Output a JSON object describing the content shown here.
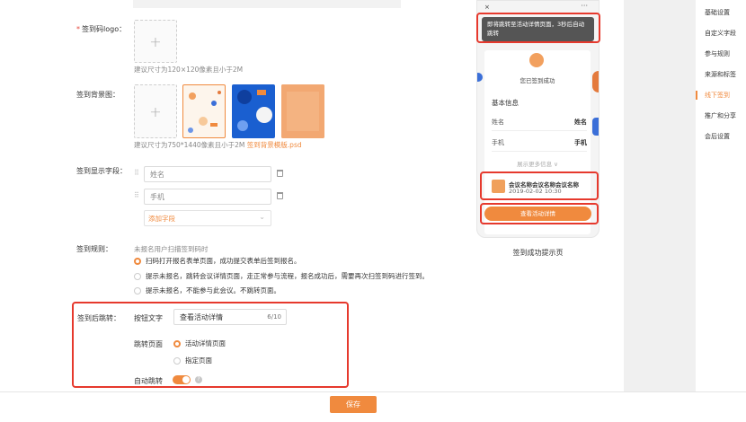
{
  "form": {
    "logo": {
      "label": "签到码logo：",
      "hint": "建议尺寸为120×120像素且小于2M",
      "upload_symbol": "+"
    },
    "background": {
      "label": "签到背景图：",
      "hint": "建议尺寸为750*1440像素且小于2M",
      "template_link": "签到背景模版.psd",
      "upload_symbol": "+"
    },
    "fields": {
      "label": "签到显示字段：",
      "items": [
        "姓名",
        "手机"
      ],
      "add_label": "添加字段"
    },
    "rule": {
      "label": "签到规则：",
      "intro": "未报名用户扫描签到码时",
      "options": [
        "扫码打开报名表单页面，成功提交表单后签到报名。",
        "提示未报名，跳转会议详情页面，走正常参与流程，报名成功后，需要再次扫签到码进行签到。",
        "提示未报名，不能参与此会议。不跳转页面。"
      ],
      "selected": 0
    },
    "after_jump": {
      "label": "签到后跳转：",
      "button_text_label": "按钮文字",
      "button_text_value": "查看活动详情",
      "button_text_count": "6/10",
      "jump_page_label": "跳转页面",
      "jump_options": [
        "活动详情页面",
        "指定页面"
      ],
      "jump_selected": 0,
      "auto_jump_label": "自动跳转",
      "auto_jump_on": true
    }
  },
  "preview": {
    "status_left": "×",
    "status_right": "···",
    "banner_text": "即将跳转至活动详情页面，3秒后自动跳转",
    "success_text": "您已签到成功",
    "section_title": "基本信息",
    "rows": [
      {
        "key": "姓名",
        "value": "姓名"
      },
      {
        "key": "手机",
        "value": "手机"
      }
    ],
    "more": "展示更多信息 ∨",
    "conference_title": "会议名称会议名称会议名称",
    "conference_date": "2019-02-02 10:30",
    "button": "查看活动详情",
    "caption": "签到成功提示页"
  },
  "sidebar": {
    "items": [
      "基础设置",
      "自定义字段",
      "参与规则",
      "来源和标签",
      "线下签到",
      "推广和分享",
      "会后设置"
    ],
    "active": 4
  },
  "footer": {
    "save": "保存"
  },
  "colors": {
    "accent": "#f08a3e",
    "highlight": "#e6392d"
  }
}
